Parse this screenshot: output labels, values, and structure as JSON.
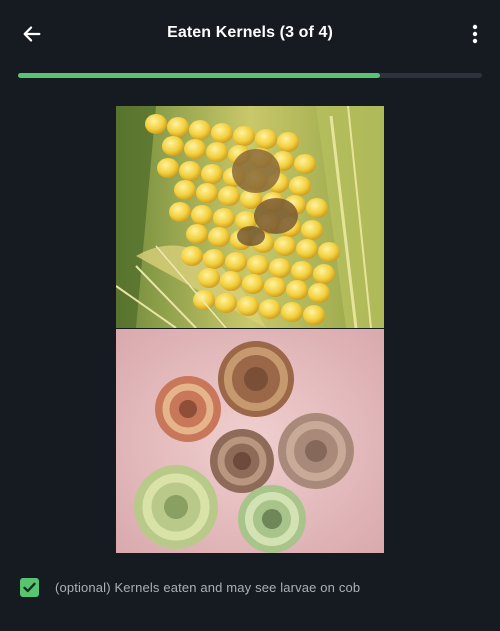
{
  "header": {
    "title": "Eaten Kernels (3 of 4)",
    "back_icon": "arrow-left-icon",
    "menu_icon": "more-vertical-icon"
  },
  "progress": {
    "value": 0.78,
    "fill_color": "#58c472",
    "track_color": "#2c333c"
  },
  "image": {
    "top_panel": "corn ear with eaten kernels",
    "bottom_panel": "curled caterpillar larvae on palm"
  },
  "option": {
    "checked": true,
    "label": "(optional) Kernels eaten and may see larvae on cob",
    "check_color": "#58c472"
  },
  "colors": {
    "background": "#161b22",
    "accent": "#58c472"
  }
}
